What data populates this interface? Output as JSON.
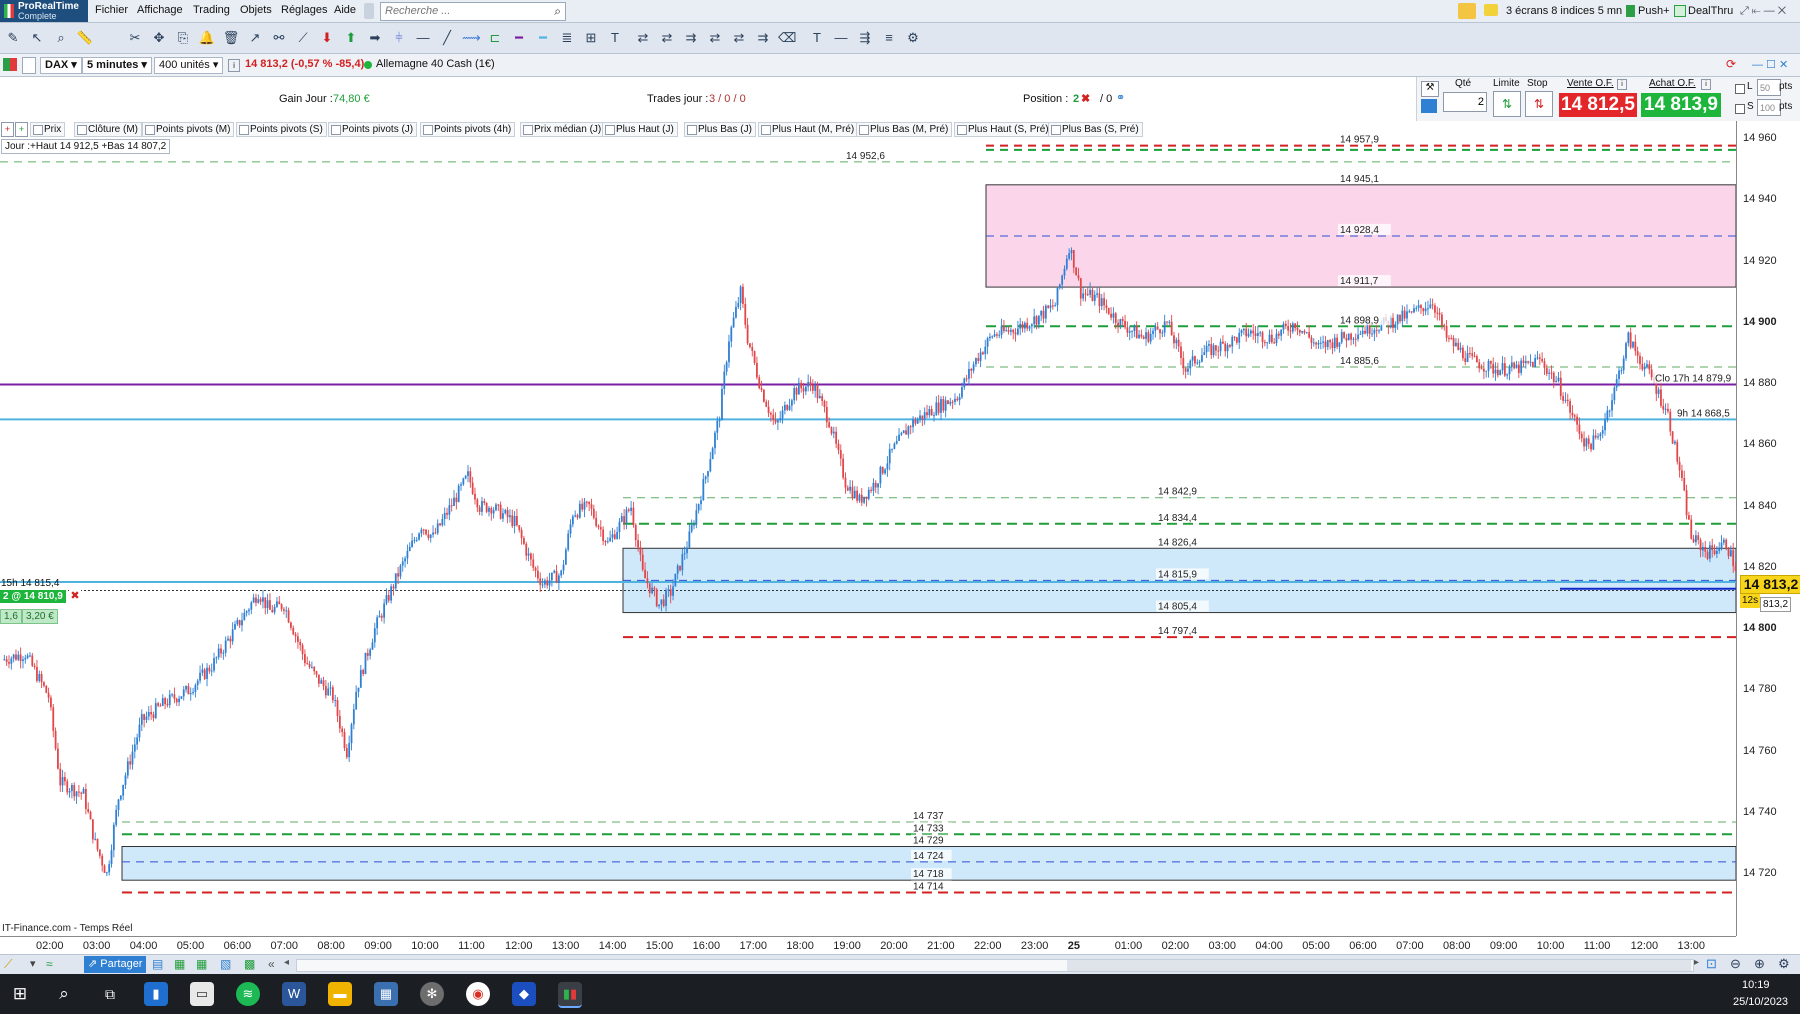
{
  "app": {
    "name": "ProRealTime",
    "edition": "Complete"
  },
  "menu": {
    "items": [
      "Fichier",
      "Affichage",
      "Trading",
      "Objets",
      "Réglages",
      "Aide"
    ]
  },
  "search": {
    "placeholder": "Recherche ..."
  },
  "top_right": {
    "layout": "3 écrans 8 indices 5 mn",
    "push": "Push+",
    "dealthru": "DealThru"
  },
  "instrument": {
    "symbol": "DAX",
    "interval": "5 minutes",
    "units": "400 unités",
    "quote": "14 813,2 (-0,57 % -85,4)",
    "market": "Allemagne 40 Cash (1€)"
  },
  "stats": {
    "gain_label": "Gain Jour :",
    "gain_value": "74,80 €",
    "trades_label": "Trades jour :",
    "trades_value": "3 / 0 / 0",
    "position_label": "Position :",
    "position_value": "2",
    "position_value2": "/ 0"
  },
  "trade_panel": {
    "qty_label": "Qté",
    "qty_value": "2",
    "limit_label": "Limite",
    "stop_label": "Stop",
    "sell_label": "Vente O.F.",
    "buy_label": "Achat O.F.",
    "sell_price": "14 812,5",
    "buy_price": "14 813,9",
    "l_label": "L",
    "l_value": "50",
    "s_label": "S",
    "s_value": "100",
    "pts": "pts"
  },
  "legend": [
    "Prix",
    "Clôture (M)",
    "Points pivots (M)",
    "Points pivots (S)",
    "Points pivots (J)",
    "Points pivots (4h)",
    "Prix médian (J)",
    "Plus Haut (J)",
    "Plus Bas (J)",
    "Plus Haut (M, Pré)",
    "Plus Bas (M, Pré)",
    "Plus Haut (S, Pré)",
    "Plus Bas (S, Pré)"
  ],
  "day_info": "Jour :+Haut 14 912,5 +Bas 14 807,2",
  "position_row": {
    "label": "15h 14 815,4",
    "badge": "2 @ 14 810,9",
    "gain_a": "1,6",
    "gain_b": "3,20 €"
  },
  "colors": {
    "up": "#2f7fd3",
    "down": "#e0464a",
    "pink_zone": "#fbd6ea",
    "blue_zone": "#cfe9fb",
    "purple": "#7b1fa2",
    "cyan": "#4fb3e0",
    "green": "#1f9d3a",
    "red": "#d32020",
    "sell": "#e3262a",
    "buy": "#1db53c"
  },
  "chart_data": {
    "type": "candlestick",
    "ylim": [
      14705,
      14963
    ],
    "yticks": [
      14720,
      14740,
      14760,
      14780,
      14800,
      14820,
      14840,
      14860,
      14880,
      14900,
      14920,
      14940,
      14960
    ],
    "ytick_labels": [
      "14 720",
      "14 740",
      "14 760",
      "14 780",
      "14 800",
      "14 820",
      "14 840",
      "14 860",
      "14 880",
      "14 900",
      "14 920",
      "14 940",
      "14 960"
    ],
    "xticks": [
      "02:00",
      "03:00",
      "04:00",
      "05:00",
      "06:00",
      "07:00",
      "08:00",
      "09:00",
      "10:00",
      "11:00",
      "12:00",
      "13:00",
      "14:00",
      "15:00",
      "16:00",
      "17:00",
      "18:00",
      "19:00",
      "20:00",
      "21:00",
      "22:00",
      "23:00",
      "25",
      "01:00",
      "02:00",
      "03:00",
      "04:00",
      "05:00",
      "06:00",
      "07:00",
      "08:00",
      "09:00",
      "10:00",
      "11:00",
      "12:00",
      "13:00"
    ],
    "path": [
      [
        0,
        14790
      ],
      [
        10,
        14792
      ],
      [
        20,
        14778
      ],
      [
        25,
        14750
      ],
      [
        35,
        14746
      ],
      [
        40,
        14730
      ],
      [
        45,
        14720
      ],
      [
        50,
        14745
      ],
      [
        60,
        14770
      ],
      [
        70,
        14776
      ],
      [
        80,
        14780
      ],
      [
        90,
        14788
      ],
      [
        100,
        14800
      ],
      [
        110,
        14812
      ],
      [
        115,
        14806
      ],
      [
        121,
        14808
      ],
      [
        130,
        14790
      ],
      [
        135,
        14784
      ],
      [
        142,
        14778
      ],
      [
        148,
        14760
      ],
      [
        152,
        14780
      ],
      [
        160,
        14800
      ],
      [
        170,
        14818
      ],
      [
        180,
        14834
      ],
      [
        185,
        14830
      ],
      [
        200,
        14850
      ],
      [
        205,
        14840
      ],
      [
        210,
        14840
      ],
      [
        220,
        14835
      ],
      [
        228,
        14820
      ],
      [
        232,
        14815
      ],
      [
        240,
        14818
      ],
      [
        245,
        14838
      ],
      [
        252,
        14840
      ],
      [
        260,
        14828
      ],
      [
        270,
        14840
      ],
      [
        275,
        14818
      ],
      [
        282,
        14808
      ],
      [
        287,
        14812
      ],
      [
        295,
        14830
      ],
      [
        302,
        14850
      ],
      [
        308,
        14870
      ],
      [
        312,
        14895
      ],
      [
        317,
        14910
      ],
      [
        320,
        14895
      ],
      [
        326,
        14878
      ],
      [
        332,
        14866
      ],
      [
        340,
        14878
      ],
      [
        348,
        14880
      ],
      [
        355,
        14868
      ],
      [
        362,
        14848
      ],
      [
        368,
        14842
      ],
      [
        375,
        14848
      ],
      [
        382,
        14858
      ],
      [
        390,
        14867
      ],
      [
        400,
        14872
      ],
      [
        410,
        14876
      ],
      [
        418,
        14888
      ],
      [
        425,
        14896
      ],
      [
        435,
        14898
      ],
      [
        445,
        14902
      ],
      [
        452,
        14906
      ],
      [
        458,
        14925
      ],
      [
        460,
        14920
      ],
      [
        463,
        14910
      ],
      [
        470,
        14908
      ],
      [
        480,
        14900
      ],
      [
        490,
        14895
      ],
      [
        500,
        14900
      ],
      [
        508,
        14885
      ],
      [
        515,
        14890
      ],
      [
        525,
        14893
      ],
      [
        535,
        14897
      ],
      [
        545,
        14895
      ],
      [
        555,
        14900
      ],
      [
        565,
        14892
      ],
      [
        575,
        14895
      ],
      [
        585,
        14898
      ],
      [
        595,
        14900
      ],
      [
        605,
        14903
      ],
      [
        614,
        14907
      ],
      [
        620,
        14895
      ],
      [
        630,
        14888
      ],
      [
        640,
        14885
      ],
      [
        650,
        14885
      ],
      [
        660,
        14888
      ],
      [
        668,
        14880
      ],
      [
        675,
        14868
      ],
      [
        680,
        14860
      ],
      [
        685,
        14862
      ],
      [
        692,
        14878
      ],
      [
        698,
        14895
      ],
      [
        703,
        14888
      ],
      [
        708,
        14882
      ],
      [
        715,
        14870
      ],
      [
        720,
        14852
      ],
      [
        725,
        14830
      ],
      [
        732,
        14825
      ],
      [
        740,
        14828
      ],
      [
        745,
        14818
      ]
    ],
    "annotations": [
      "14 957,9",
      "14 952,6",
      "14 945,1",
      "14 928,4",
      "14 911,7",
      "14 898,9",
      "14 885,6",
      "14 842,9",
      "14 834,4",
      "14 826,4",
      "14 815,9",
      "14 805,4",
      "14 797,4",
      "14 737",
      "14 733",
      "14 729",
      "14 724",
      "14 718",
      "14 714",
      "Clo 17h 14 879,9",
      "9h 14 868,5"
    ],
    "current_price": "14 813,2",
    "timer": "12s",
    "tag_small": "813,2",
    "source": "IT-Finance.com - Temps Réel"
  },
  "bottom": {
    "share": "Partager"
  },
  "taskbar": {
    "time": "10:19",
    "date": "25/10/2023"
  }
}
